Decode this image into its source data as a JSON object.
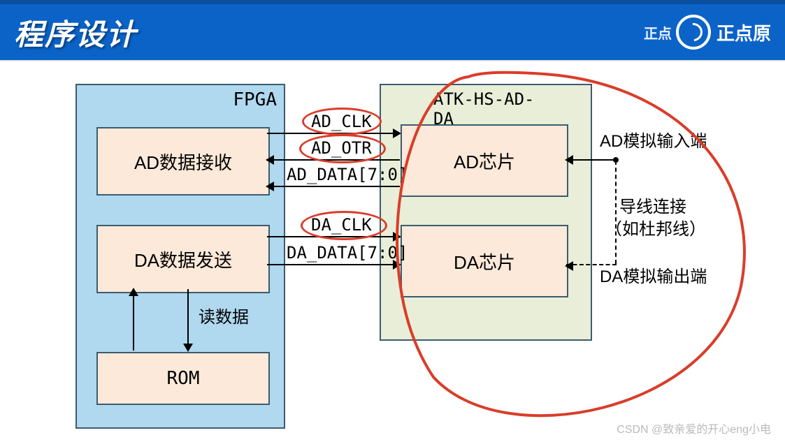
{
  "header": {
    "title": "程序设计",
    "brand": "正点原",
    "brand_small": "正点"
  },
  "fpga": {
    "label": "FPGA"
  },
  "blocks": {
    "ad_recv": "AD数据接收",
    "da_send": "DA数据发送",
    "rom": "ROM",
    "read_data": "读数据"
  },
  "signals": {
    "ad_clk": "AD_CLK",
    "ad_otr": "AD_OTR",
    "ad_data": "AD_DATA[7:0]",
    "da_clk": "DA_CLK",
    "da_data": "DA_DATA[7:0]"
  },
  "adda": {
    "label": "ATK-HS-AD-DA",
    "ad_chip": "AD芯片",
    "da_chip": "DA芯片"
  },
  "right": {
    "ad_in": "AD模拟输入端",
    "note1": "导线连接",
    "note2": "（如杜邦线）",
    "da_out": "DA模拟输出端"
  },
  "watermark": "CSDN @致亲爱的开心eng小电"
}
